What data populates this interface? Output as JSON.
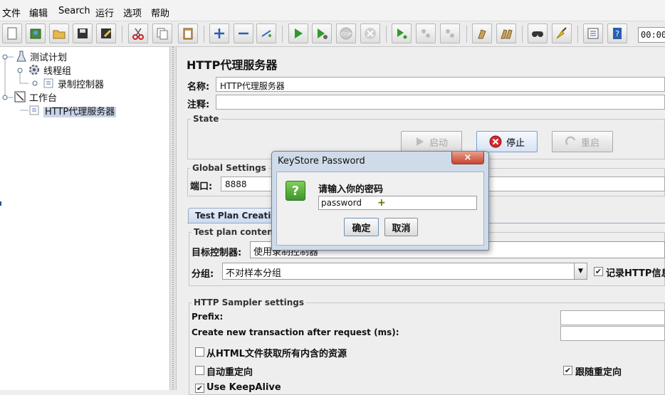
{
  "menu": [
    "文件",
    "编辑",
    "Search",
    "运行",
    "选项",
    "帮助"
  ],
  "toolbar": {
    "icons": [
      "new-icon",
      "templates-icon",
      "open-icon",
      "save-icon",
      "save-as-icon",
      "cut-icon",
      "copy-icon",
      "paste-icon",
      "expand-icon",
      "collapse-icon",
      "toggle-icon",
      "start-icon",
      "start-no-pause-icon",
      "stop-icon",
      "shutdown-icon",
      "remote-start-icon",
      "remote-stop-icon",
      "remote-shutdown-icon",
      "clear-icon",
      "clear-all-icon",
      "search-icon",
      "reset-search-icon",
      "function-helper-icon",
      "help-icon"
    ],
    "timer": "00:00"
  },
  "tree": {
    "nodes": [
      {
        "label": "测试计划",
        "icon": "test-plan-icon"
      },
      {
        "label": "线程组",
        "icon": "thread-group-icon"
      },
      {
        "label": "录制控制器",
        "icon": "recording-controller-icon"
      },
      {
        "label": "工作台",
        "icon": "workbench-icon"
      },
      {
        "label": "HTTP代理服务器",
        "icon": "proxy-server-icon",
        "selected": true
      }
    ]
  },
  "panel": {
    "title": "HTTP代理服务器",
    "name_label": "名称:",
    "name_value": "HTTP代理服务器",
    "comment_label": "注释:",
    "comment_value": "",
    "state_group": "State",
    "start_button": "启动",
    "stop_button": "停止",
    "restart_button": "重启",
    "global_group": "Global Settings",
    "port_label": "端口:",
    "port_value": "8888",
    "tab_label": "Test Plan Creation",
    "content_group": "Test plan content",
    "target_label": "目标控制器:",
    "target_value": "使用录制控制器",
    "grouping_label": "分组:",
    "grouping_value": "不对样本分组",
    "record_http_label": "记录HTTP信息",
    "record_http_checked": true,
    "sampler_group": "HTTP Sampler settings",
    "prefix_label": "Prefix:",
    "prefix_value": "",
    "create_tx_label": "Create new transaction after request (ms):",
    "create_tx_value": "",
    "retrieve_label": "从HTML文件获取所有内含的资源",
    "retrieve_checked": false,
    "auto_redirect_label": "自动重定向",
    "auto_redirect_checked": false,
    "follow_redirect_label": "跟随重定向",
    "follow_redirect_checked": true,
    "keepalive_label": "Use KeepAlive",
    "keepalive_checked": true
  },
  "dialog": {
    "title": "KeyStore Password",
    "close_glyph": "×",
    "prompt": "请输入你的密码",
    "input_value": "password",
    "ok_button": "确定",
    "cancel_button": "取消"
  },
  "colors": {
    "selection": "#c8d4e8",
    "dialog_frame": "#cfdbe9",
    "close_button": "#c8452e",
    "question_icon": "#3c962a"
  }
}
